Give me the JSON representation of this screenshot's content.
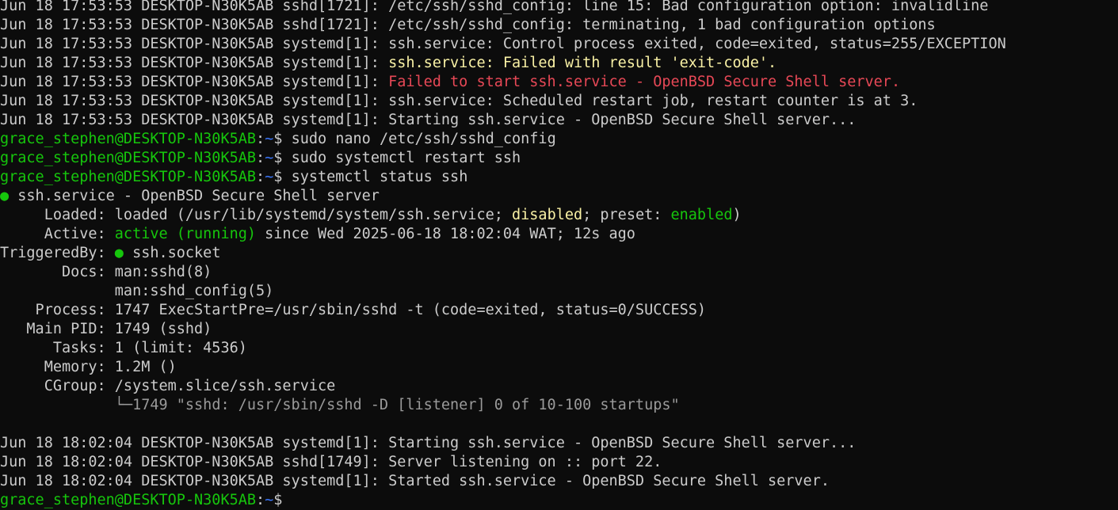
{
  "terminal": {
    "lines": [
      [
        {
          "t": "Jun 18 17:53:53 DESKTOP-N30K5AB sshd[1721]: /etc/ssh/sshd_config: line 15: Bad configuration option: invalidline"
        }
      ],
      [
        {
          "t": "Jun 18 17:53:53 DESKTOP-N30K5AB sshd[1721]: /etc/ssh/sshd_config: terminating, 1 bad configuration options"
        }
      ],
      [
        {
          "t": "Jun 18 17:53:53 DESKTOP-N30K5AB systemd[1]: ssh.service: Control process exited, code=exited, status=255/EXCEPTION"
        }
      ],
      [
        {
          "t": "Jun 18 17:53:53 DESKTOP-N30K5AB systemd[1]: "
        },
        {
          "t": "ssh.service: Failed with result 'exit-code'.",
          "c": "yellow"
        }
      ],
      [
        {
          "t": "Jun 18 17:53:53 DESKTOP-N30K5AB systemd[1]: "
        },
        {
          "t": "Failed to start ssh.service - OpenBSD Secure Shell server.",
          "c": "red"
        }
      ],
      [
        {
          "t": "Jun 18 17:53:53 DESKTOP-N30K5AB systemd[1]: ssh.service: Scheduled restart job, restart counter is at 3."
        }
      ],
      [
        {
          "t": "Jun 18 17:53:53 DESKTOP-N30K5AB systemd[1]: Starting ssh.service - OpenBSD Secure Shell server..."
        }
      ],
      [
        {
          "t": "grace_stephen@DESKTOP-N30K5AB",
          "c": "user"
        },
        {
          "t": ":"
        },
        {
          "t": "~",
          "c": "path"
        },
        {
          "t": "$ sudo nano /etc/ssh/sshd_config"
        }
      ],
      [
        {
          "t": "grace_stephen@DESKTOP-N30K5AB",
          "c": "user"
        },
        {
          "t": ":"
        },
        {
          "t": "~",
          "c": "path"
        },
        {
          "t": "$ sudo systemctl restart ssh"
        }
      ],
      [
        {
          "t": "grace_stephen@DESKTOP-N30K5AB",
          "c": "user"
        },
        {
          "t": ":"
        },
        {
          "t": "~",
          "c": "path"
        },
        {
          "t": "$ systemctl status ssh"
        }
      ],
      [
        {
          "t": "●",
          "c": "green"
        },
        {
          "t": " ssh.service - OpenBSD Secure Shell server"
        }
      ],
      [
        {
          "t": "     Loaded: loaded (/usr/lib/systemd/system/ssh.service; "
        },
        {
          "t": "disabled",
          "c": "yellow"
        },
        {
          "t": "; preset: "
        },
        {
          "t": "enabled",
          "c": "green"
        },
        {
          "t": ")"
        }
      ],
      [
        {
          "t": "     Active: "
        },
        {
          "t": "active (running)",
          "c": "green"
        },
        {
          "t": " since Wed 2025-06-18 18:02:04 WAT; 12s ago"
        }
      ],
      [
        {
          "t": "TriggeredBy: "
        },
        {
          "t": "●",
          "c": "green"
        },
        {
          "t": " ssh.socket"
        }
      ],
      [
        {
          "t": "       Docs: man:sshd(8)"
        }
      ],
      [
        {
          "t": "             man:sshd_config(5)"
        }
      ],
      [
        {
          "t": "    Process: 1747 ExecStartPre=/usr/sbin/sshd -t (code=exited, status=0/SUCCESS)"
        }
      ],
      [
        {
          "t": "   Main PID: 1749 (sshd)"
        }
      ],
      [
        {
          "t": "      Tasks: 1 (limit: 4536)"
        }
      ],
      [
        {
          "t": "     Memory: 1.2M ()"
        }
      ],
      [
        {
          "t": "     CGroup: /system.slice/ssh.service"
        }
      ],
      [
        {
          "t": "             "
        },
        {
          "t": "└─1749 \"sshd: /usr/sbin/sshd -D [listener] 0 of 10-100 startups\"",
          "c": "dim"
        }
      ],
      [
        {
          "t": ""
        }
      ],
      [
        {
          "t": "Jun 18 18:02:04 DESKTOP-N30K5AB systemd[1]: Starting ssh.service - OpenBSD Secure Shell server..."
        }
      ],
      [
        {
          "t": "Jun 18 18:02:04 DESKTOP-N30K5AB sshd[1749]: Server listening on :: port 22."
        }
      ],
      [
        {
          "t": "Jun 18 18:02:04 DESKTOP-N30K5AB systemd[1]: Started ssh.service - OpenBSD Secure Shell server."
        }
      ],
      [
        {
          "t": "grace_stephen@DESKTOP-N30K5AB",
          "c": "user"
        },
        {
          "t": ":"
        },
        {
          "t": "~",
          "c": "path"
        },
        {
          "t": "$ "
        }
      ]
    ]
  },
  "colors": {
    "background": "#0c0c0c",
    "foreground": "#cccccc",
    "yellow": "#f9f1a5",
    "red": "#e74856",
    "green": "#16c60c",
    "path_blue": "#3b78ff"
  }
}
